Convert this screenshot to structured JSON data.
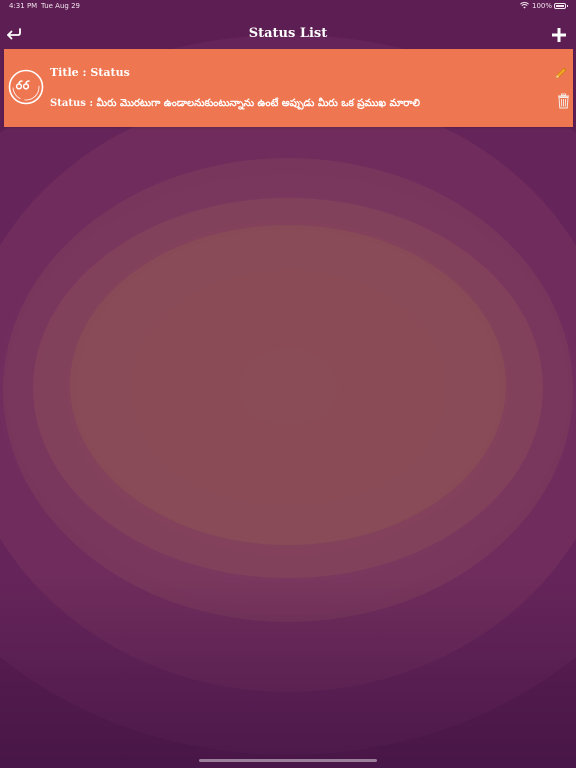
{
  "status_bar": {
    "time": "4:31 PM",
    "date": "Tue Aug 29",
    "battery": "100%",
    "icons": [
      "wifi-icon",
      "battery-icon"
    ]
  },
  "nav": {
    "title": "Status List",
    "back_icon": "back-arrow-icon",
    "add_icon": "plus-icon"
  },
  "items": [
    {
      "title": "Title : Status",
      "status": "Status : మీరు మొరటుగా ఉండాలనుకుంటున్నాను ఉంటే అప్పుడు మీరు ఒక ప్రముఖ మారాలి",
      "icon": "quote-icon",
      "actions": [
        "pencil-icon",
        "trash-icon"
      ]
    }
  ],
  "colors": {
    "card": "#ee7651",
    "background": "#6b2a60",
    "edit_icon": "#f5a623",
    "text": "#ffffff"
  }
}
